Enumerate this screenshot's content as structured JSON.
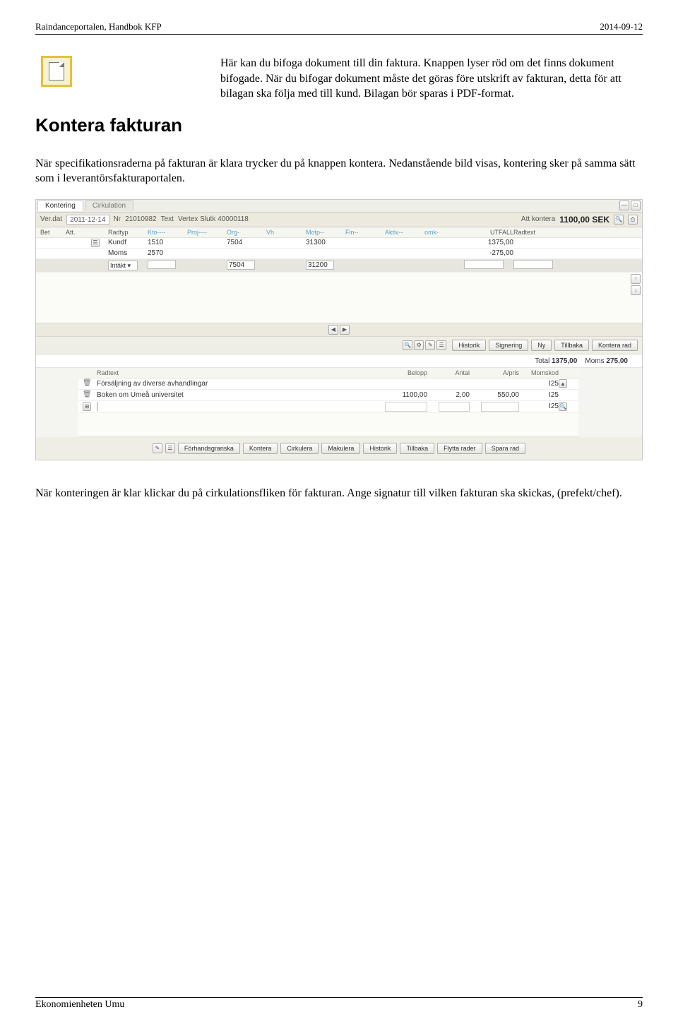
{
  "header": {
    "left": "Raindanceportalen, Handbok KFP",
    "right": "2014-09-12"
  },
  "intro": "Här kan du bifoga dokument till din faktura. Knappen lyser röd om det finns dokument bifogade. När du bifogar dokument måste det göras före utskrift av fakturan, detta för att bilagan ska följa med till kund. Bilagan bör sparas i PDF-format.",
  "heading": "Kontera fakturan",
  "para1": "När specifikationsraderna på fakturan är klara trycker du på knappen kontera. Nedanstående bild visas, kontering sker på samma sätt som i leverantörsfakturaportalen.",
  "para2": "När konteringen är klar klickar du på cirkulationsfliken för fakturan. Ange signatur till vilken fakturan ska skickas, (prefekt/chef).",
  "footer": {
    "left": "Ekonomienheten Umu",
    "right": "9"
  },
  "shot": {
    "tabs": {
      "active": "Kontering",
      "inactive": "Cirkulation"
    },
    "ver": {
      "label_date": "Ver.dat",
      "date": "2011-12-14",
      "label_nr": "Nr",
      "nr": "21010982",
      "label_text": "Text",
      "text": "Vertex Slutk 40000118",
      "att_label": "Att kontera",
      "att_amount": "1100,00 SEK"
    },
    "columns": {
      "bet": "Bet",
      "att": "Att.",
      "radtyp": "Radtyp",
      "kto": "Kto----",
      "proj": "Proj----",
      "org": "Org-",
      "vh": "Vh",
      "motp": "Motp--",
      "fin": "Fin--",
      "aktiv": "Aktiv--",
      "omk": "omk-",
      "utfall": "UTFALL",
      "radtext": "Radtext"
    },
    "rows": [
      {
        "radtyp": "Kundf",
        "kto": "1510",
        "org": "7504",
        "motp": "31300",
        "utfall": "1375,00"
      },
      {
        "radtyp": "Moms",
        "kto": "2570",
        "utfall": "-275,00"
      },
      {
        "radtyp_dd": "Intäkt ▾",
        "org_box": "7504",
        "motp_box": "31200"
      }
    ],
    "midbtns": {
      "historik": "Historik",
      "signering": "Signering",
      "ny": "Ny",
      "tillbaka": "Tillbaka",
      "kontera_rad": "Kontera rad"
    },
    "totals": {
      "label_total": "Total",
      "total": "1375,00",
      "label_moms": "Moms",
      "moms": "275,00"
    },
    "subcols": {
      "radtext": "Radtext",
      "belopp": "Belopp",
      "antal": "Antal",
      "apris": "A/pris",
      "momskod": "Momskod"
    },
    "subrows": [
      {
        "text": "Försäljning av diverse avhandlingar",
        "moms": "I25"
      },
      {
        "text": "Boken om Umeå universitet",
        "belopp": "1100,00",
        "antal": "2,00",
        "apris": "550,00",
        "moms": "I25"
      },
      {
        "empty": true,
        "moms": "I25"
      }
    ],
    "bottom": {
      "forhand": "Förhandsgranska",
      "kontera": "Kontera",
      "cirkulera": "Cirkulera",
      "makulera": "Makulera",
      "historik": "Historik",
      "tillbaka": "Tillbaka",
      "flytta": "Flytta rader",
      "spara": "Spara rad"
    }
  }
}
